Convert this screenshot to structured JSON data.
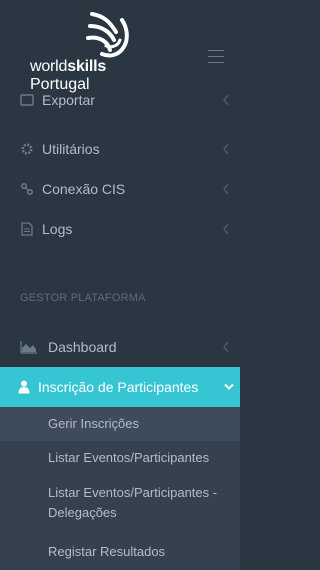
{
  "brand": {
    "line1_regular": "world",
    "line1_bold": "skills",
    "line2": "Portugal"
  },
  "colors": {
    "sidebar_bg": "#2b3643",
    "submenu_bg": "#364150",
    "active_bg": "#36c6d3",
    "text": "#b4bcc8",
    "section_header": "#5c6b7a"
  },
  "menu": {
    "partial_item": {
      "label": "Exportar",
      "icon": "export-icon"
    },
    "items": [
      {
        "label": "Utilitários",
        "icon": "gear-icon"
      },
      {
        "label": "Conexão CIS",
        "icon": "link-icon"
      },
      {
        "label": "Logs",
        "icon": "file-icon"
      }
    ],
    "section_header": "GESTOR PLATAFORMA",
    "dashboard": {
      "label": "Dashboard",
      "icon": "chart-area-icon"
    },
    "active": {
      "label": "Inscrição de Participantes",
      "icon": "user-icon"
    },
    "submenu": [
      {
        "label": "Gerir Inscrições"
      },
      {
        "label": "Listar Eventos/Participantes"
      },
      {
        "label": "Listar Eventos/Participantes - Delegações"
      },
      {
        "label": "Registar Resultados"
      }
    ]
  }
}
